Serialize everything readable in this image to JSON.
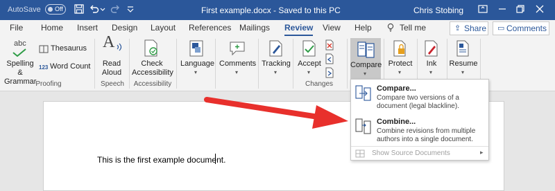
{
  "titlebar": {
    "autosave_label": "AutoSave",
    "autosave_state": "Off",
    "doc_title": "First example.docx  -  Saved to this PC",
    "user_name": "Chris Stobing"
  },
  "tabs": [
    "File",
    "Home",
    "Insert",
    "Design",
    "Layout",
    "References",
    "Mailings",
    "Review",
    "View",
    "Help"
  ],
  "tell_me": "Tell me",
  "share_label": "Share",
  "comments_label": "Comments",
  "ribbon": {
    "spelling_label": "Spelling &\nGrammar",
    "spelling_icon_text": "abc",
    "thesaurus_label": "Thesaurus",
    "word_count_label": "Word Count",
    "word_count_icon_text": "123",
    "read_aloud_label": "Read\nAloud",
    "check_accessibility_label": "Check\nAccessibility",
    "language_label": "Language",
    "comments_label": "Comments",
    "tracking_label": "Tracking",
    "accept_label": "Accept",
    "compare_label": "Compare",
    "protect_label": "Protect",
    "ink_label": "Ink",
    "resume_label": "Resume",
    "groups": {
      "proofing": "Proofing",
      "speech": "Speech",
      "accessibility": "Accessibility",
      "changes": "Changes"
    }
  },
  "compare_menu": {
    "compare_title": "Compare...",
    "compare_desc": "Compare two versions of a\ndocument (legal blackline).",
    "combine_title": "Combine...",
    "combine_desc": "Combine revisions from multiple\nauthors into a single document.",
    "show_source": "Show Source Documents"
  },
  "document": {
    "text": "This is the first example document."
  },
  "colors": {
    "title_bar": "#2b579a",
    "accent": "#2b579a",
    "arrow": "#e8302c"
  }
}
